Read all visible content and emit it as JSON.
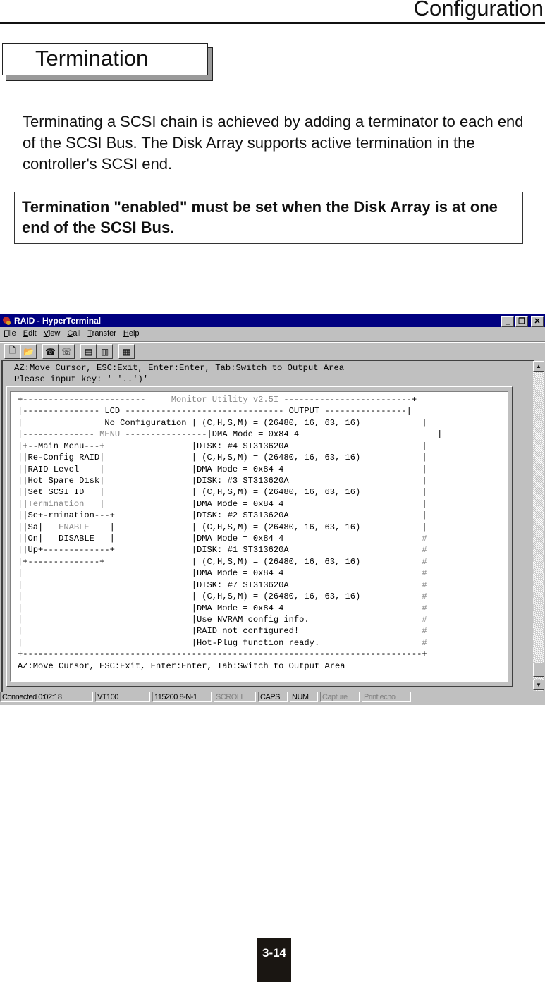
{
  "header": {
    "title": "Configuration"
  },
  "section": {
    "title": "Termination"
  },
  "body_text": "Terminating a SCSI chain is achieved by adding a terminator to each end of the SCSI Bus. The Disk Array  supports active termination in the controller's SCSI end.",
  "note_text": "Termination \"enabled\" must be set when the Disk Array is at one end of the SCSI Bus.",
  "window": {
    "title": "RAID - HyperTerminal",
    "app_icon": "hyperterminal-icon",
    "controls": {
      "minimize": "_",
      "restore": "❐",
      "close": "✕"
    },
    "menu": [
      {
        "label": "File",
        "accel": "F"
      },
      {
        "label": "Edit",
        "accel": "E"
      },
      {
        "label": "View",
        "accel": "V"
      },
      {
        "label": "Call",
        "accel": "C"
      },
      {
        "label": "Transfer",
        "accel": "T"
      },
      {
        "label": "Help",
        "accel": "H"
      }
    ],
    "toolbar": [
      "new-icon",
      "open-icon",
      "connect-icon",
      "disconnect-icon",
      "send-icon",
      "receive-icon",
      "properties-icon"
    ],
    "terminal_header": [
      "AZ:Move Cursor, ESC:Exit, Enter:Enter, Tab:Switch to Output Area",
      "Please input key: ' '..')'"
    ],
    "terminal": {
      "title_line": {
        "left": "+------------------------    ",
        "title": " Monitor Utility v2.5I ",
        "right": "-------------------------+"
      },
      "lcd_line": {
        "left": "|--------------- ",
        "lcd": "LCD",
        "mid": " ------------------------------- ",
        "output": "OUTPUT",
        "right": " ----------------|"
      },
      "lines": [
        {
          "left": "|                No Configuration ",
          "right": "| (C,H,S,M) = (26480, 16, 63, 16)",
          "end": "|"
        },
        {
          "left": "|-------------- ",
          "menu": "MENU",
          "left2": " ----------------",
          "right": "|DMA Mode = 0x84 4",
          "end": "|"
        },
        {
          "left": "|+--Main Menu---+                 ",
          "right": "|DISK: #4 ST313620A",
          "end": "|"
        },
        {
          "left": "||Re-Config RAID|                 ",
          "right": "| (C,H,S,M) = (26480, 16, 63, 16)",
          "end": "|"
        },
        {
          "left": "||RAID Level    |                 ",
          "right": "|DMA Mode = 0x84 4",
          "end": "|"
        },
        {
          "left": "||Hot Spare Disk|                 ",
          "right": "|DISK: #3 ST313620A",
          "end": "|"
        },
        {
          "left": "||Set SCSI ID   |                 ",
          "right": "| (C,H,S,M) = (26480, 16, 63, 16)",
          "end": "|"
        },
        {
          "left": "||",
          "gray": "Termination",
          "left2": "   |                 ",
          "right": "|DMA Mode = 0x84 4",
          "end": "|"
        },
        {
          "left": "||Se+-rmination---+               ",
          "right": "|DISK: #2 ST313620A",
          "end": "|"
        },
        {
          "left": "||Sa|   ",
          "gray": "ENABLE",
          "left2": "    |               ",
          "right": "| (C,H,S,M) = (26480, 16, 63, 16)",
          "end": "|"
        },
        {
          "left": "||On|   DISABLE   |               ",
          "right": "|DMA Mode = 0x84 4",
          "end": "#"
        },
        {
          "left": "||Up+-------------+               ",
          "right": "|DISK: #1 ST313620A",
          "end": "#"
        },
        {
          "left": "|+--------------+                 ",
          "right": "| (C,H,S,M) = (26480, 16, 63, 16)",
          "end": "#"
        },
        {
          "left": "|                                 ",
          "right": "|DMA Mode = 0x84 4",
          "end": "#"
        },
        {
          "left": "|                                 ",
          "right": "|DISK: #7 ST313620A",
          "end": "#"
        },
        {
          "left": "|                                 ",
          "right": "| (C,H,S,M) = (26480, 16, 63, 16)",
          "end": "#"
        },
        {
          "left": "|                                 ",
          "right": "|DMA Mode = 0x84 4",
          "end": "#"
        },
        {
          "left": "|                                 ",
          "right": "|Use NVRAM config info.",
          "end": "#"
        },
        {
          "left": "|                                 ",
          "right": "|RAID not configured!",
          "end": "#"
        },
        {
          "left": "|                                 ",
          "right": "|Hot-Plug function ready.",
          "end": "#"
        }
      ],
      "bottom_line": "+------------------------------------------------------------------------------+",
      "footer": "AZ:Move Cursor, ESC:Exit, Enter:Enter, Tab:Switch to Output Area"
    },
    "statusbar": [
      {
        "label": "Connected 0:02:18",
        "dim": false
      },
      {
        "label": "VT100",
        "dim": false
      },
      {
        "label": "115200 8-N-1",
        "dim": false
      },
      {
        "label": "SCROLL",
        "dim": true
      },
      {
        "label": "CAPS",
        "dim": false
      },
      {
        "label": "NUM",
        "dim": false
      },
      {
        "label": "Capture",
        "dim": true
      },
      {
        "label": "Print echo",
        "dim": true
      }
    ]
  },
  "page_number": "3-14"
}
